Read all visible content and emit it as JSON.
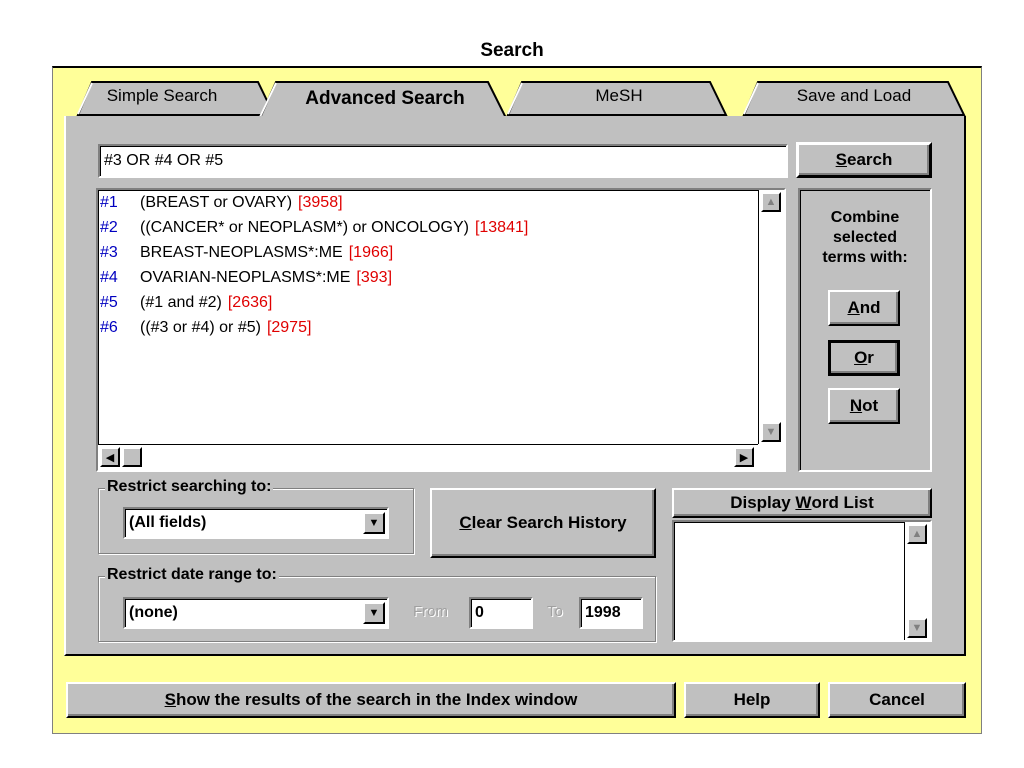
{
  "window": {
    "title": "Search"
  },
  "tabs": [
    {
      "label": "Simple Search"
    },
    {
      "label": "Advanced Search"
    },
    {
      "label": "MeSH"
    },
    {
      "label": "Save and Load"
    }
  ],
  "query": {
    "value": "#3 OR #4 OR #5"
  },
  "search_button": {
    "label": "Search",
    "accel": "S",
    "rest": "earch"
  },
  "history": [
    {
      "num": "#1",
      "text": "(BREAST or OVARY)",
      "count": "[3958]"
    },
    {
      "num": "#2",
      "text": "((CANCER* or NEOPLASM*) or ONCOLOGY)",
      "count": "[13841]"
    },
    {
      "num": "#3",
      "text": "BREAST-NEOPLASMS*:ME",
      "count": "[1966]"
    },
    {
      "num": "#4",
      "text": "OVARIAN-NEOPLASMS*:ME",
      "count": "[393]"
    },
    {
      "num": "#5",
      "text": "(#1 and #2)",
      "count": "[2636]"
    },
    {
      "num": "#6",
      "text": "((#3 or #4) or #5)",
      "count": "[2975]"
    }
  ],
  "combine": {
    "label": "Combine selected terms with:",
    "and": {
      "accel": "A",
      "rest": "nd"
    },
    "or": {
      "accel": "O",
      "rest": "r"
    },
    "not": {
      "accel": "N",
      "rest": "ot"
    }
  },
  "restrict_fields": {
    "label": "Restrict searching to:",
    "value": "(All fields)"
  },
  "clear_history": {
    "accel": "C",
    "rest": "lear Search History"
  },
  "display_word_list": {
    "pre": "Display ",
    "accel": "W",
    "rest": "ord List"
  },
  "restrict_date": {
    "label": "Restrict date range to:",
    "value": "(none)",
    "from_label": "From",
    "from_value": "0",
    "to_label": "To",
    "to_value": "1998"
  },
  "show_results": {
    "accel": "S",
    "rest": "how the results of the search in the Index window"
  },
  "help_button": {
    "label": "Help"
  },
  "cancel_button": {
    "label": "Cancel"
  },
  "colors": {
    "face": "#c0c0c0",
    "frame": "#ffff99",
    "number": "#0000c0",
    "count": "#e00000"
  }
}
